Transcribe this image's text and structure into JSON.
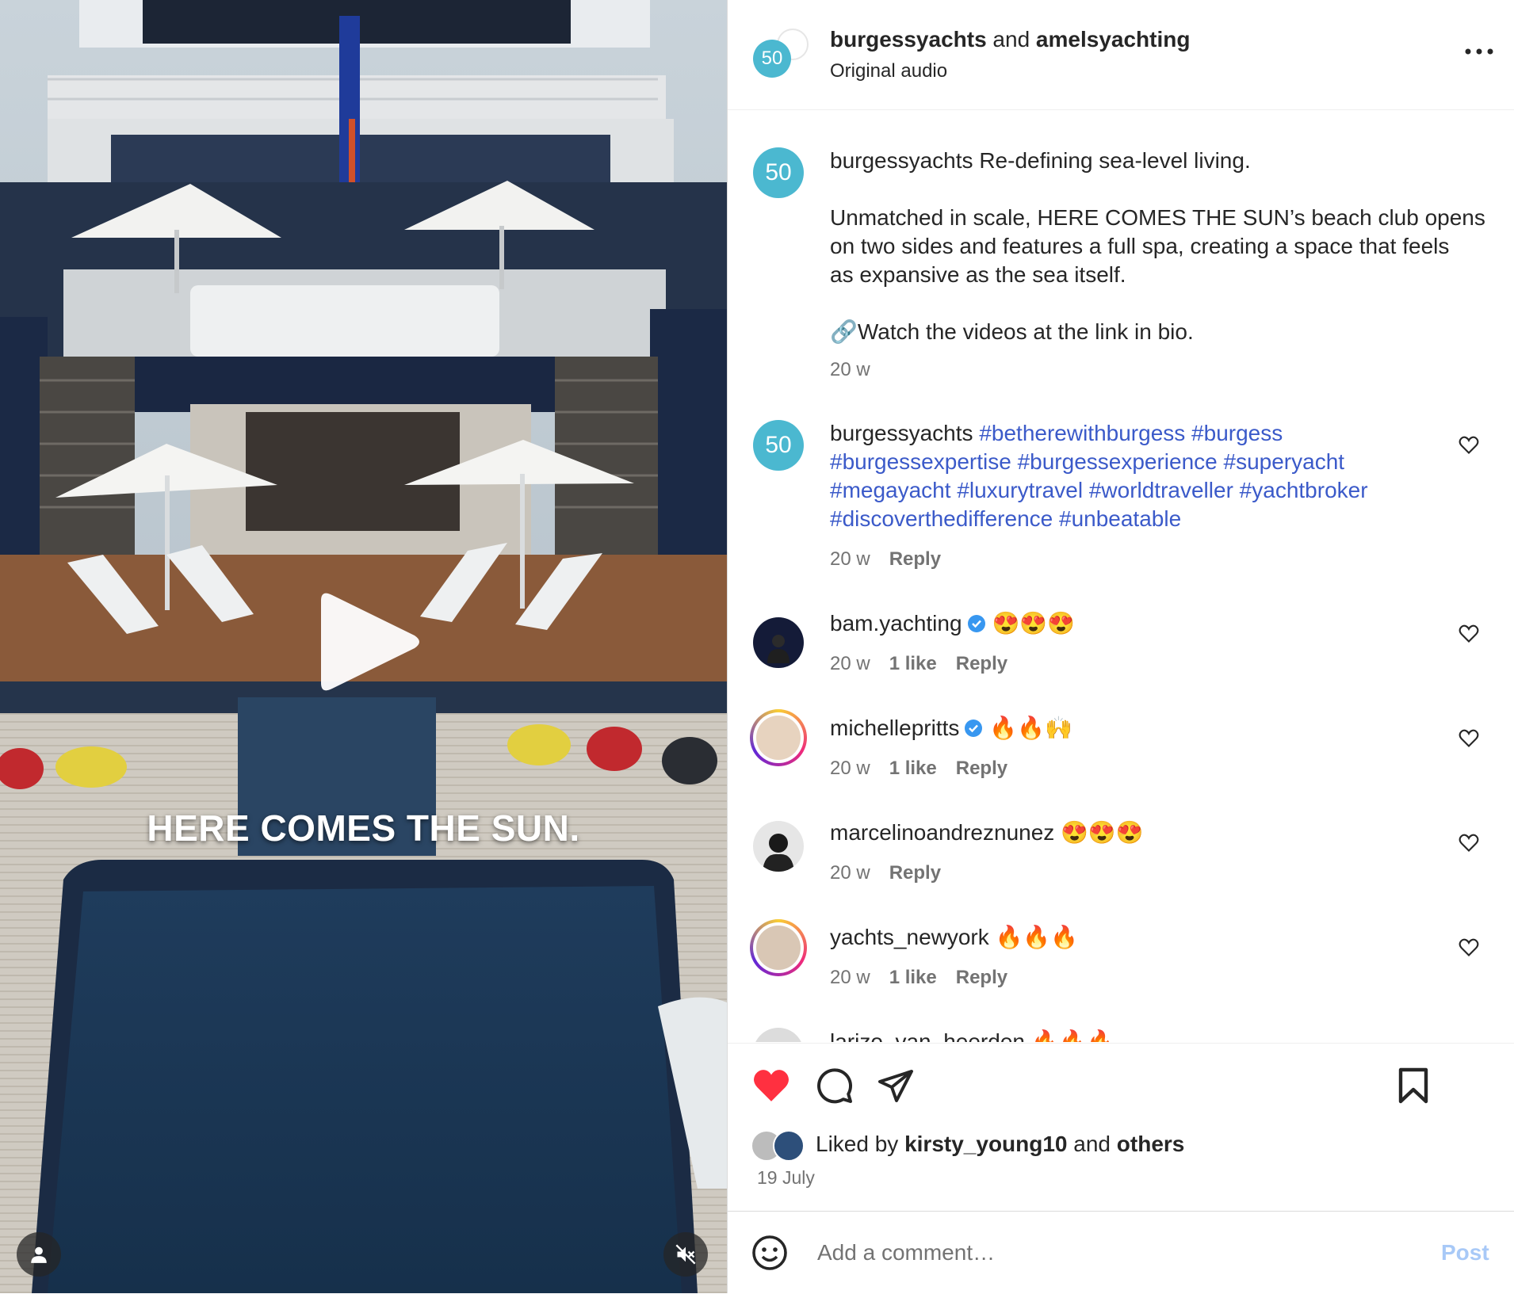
{
  "media": {
    "overlay_text": "HERE COMES THE SUN.",
    "play_icon": "play-icon",
    "user_icon": "person-icon",
    "mute_icon": "speaker-muted-icon"
  },
  "header": {
    "author": "burgessyachts",
    "joiner": "and",
    "coauthor": "amelsyachting",
    "audio": "Original audio",
    "avatar_text": "50",
    "more_icon": "more-horizontal-icon"
  },
  "caption": {
    "username": "burgessyachts",
    "line1": "Re-defining sea-level living.",
    "para2_l1": "Unmatched in scale, HERE COMES THE SUN’s beach club opens",
    "para2_l2": "on two sides and features a full spa, creating a space that feels",
    "para2_l3": "as expansive as the sea itself.",
    "para3": "🔗Watch the videos at the link in bio.",
    "time": "20 w"
  },
  "comments": [
    {
      "username": "burgessyachts",
      "tags_l1": "#betherewithburgess #burgess",
      "tags_l2": "#burgessexpertise #burgessexperience #superyacht",
      "tags_l3": "#megayacht #luxurytravel #worldtraveller #yachtbroker",
      "tags_l4": "#discoverthedifference #unbeatable",
      "time": "20 w",
      "reply": "Reply"
    },
    {
      "username": "bam.yachting",
      "text": "😍😍😍",
      "time": "20 w",
      "likes": "1 like",
      "reply": "Reply",
      "verified": true
    },
    {
      "username": "michellepritts",
      "text": "🔥🔥🙌",
      "time": "20 w",
      "likes": "1 like",
      "reply": "Reply",
      "verified": true
    },
    {
      "username": "marcelinoandreznunez",
      "text": "😍😍😍",
      "time": "20 w",
      "reply": "Reply"
    },
    {
      "username": "yachts_newyork",
      "text": "🔥🔥🔥",
      "time": "20 w",
      "likes": "1 like",
      "reply": "Reply"
    },
    {
      "username": "larizo_van_heerden",
      "text": "🔥🔥🔥"
    }
  ],
  "actions": {
    "like_icon": "heart-filled-icon",
    "comment_icon": "comment-icon",
    "share_icon": "send-icon",
    "save_icon": "bookmark-icon"
  },
  "likes": {
    "prefix": "Liked by",
    "user": "kirsty_young10",
    "joiner": "and",
    "others": "others"
  },
  "date": "19 July",
  "add_comment": {
    "placeholder": "Add a comment…",
    "post_label": "Post",
    "emoji_icon": "smiley-icon"
  },
  "colors": {
    "accent_blue": "#3b5ac9",
    "like_red": "#ff3040",
    "post_disabled": "#a8c9f7",
    "brand_teal": "#4bb8d0"
  }
}
